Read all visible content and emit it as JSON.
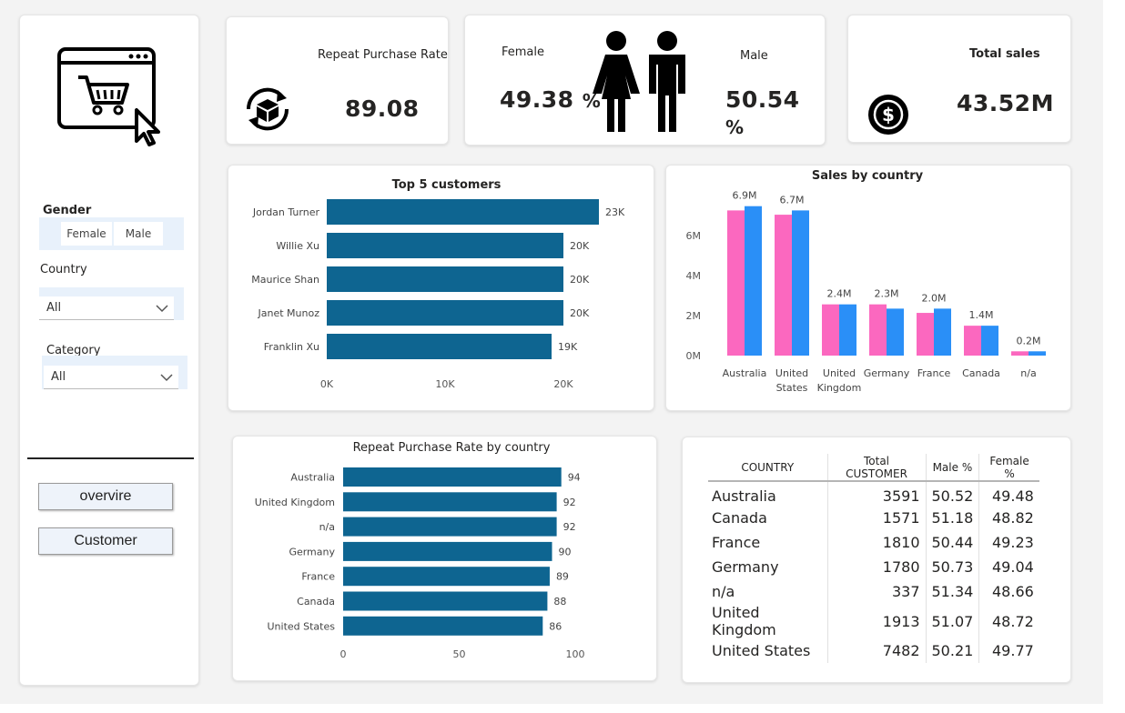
{
  "sidebar": {
    "logo_icon": "shopping-cart-browser-icon",
    "gender": {
      "title": "Gender",
      "options": [
        "Female",
        "Male"
      ]
    },
    "country": {
      "title": "Country",
      "value": "All"
    },
    "category": {
      "title": "Category",
      "value": "All"
    },
    "buttons": [
      "overvire",
      "Customer"
    ]
  },
  "kpis": {
    "repeat_rate": {
      "label": "Repeat Purchase Rate",
      "value": "89.08",
      "icon": "repeat-box-icon"
    },
    "gender": {
      "female_label": "Female",
      "female_value": "49.38",
      "male_label": "Male",
      "male_value": "50.54",
      "unit": "%",
      "icon": "female-male-icon"
    },
    "total_sales": {
      "label": "Total sales",
      "value": "43.52M",
      "icon": "dollar-coin-icon"
    }
  },
  "colors": {
    "bar_blue": "#0e6591",
    "female_pink": "#fb68bf",
    "male_blue": "#2a8ff7"
  },
  "chart_data": [
    {
      "type": "bar",
      "orientation": "horizontal",
      "title": "Top 5 customers",
      "categories": [
        "Jordan Turner",
        "Willie Xu",
        "Maurice Shan",
        "Janet Munoz",
        "Franklin Xu"
      ],
      "values": [
        23000,
        20000,
        20000,
        20000,
        19000
      ],
      "data_labels": [
        "23K",
        "20K",
        "20K",
        "20K",
        "19K"
      ],
      "x_ticks": [
        "0K",
        "10K",
        "20K"
      ],
      "xlim": [
        0,
        25000
      ]
    },
    {
      "type": "bar",
      "title": "Sales by country",
      "categories": [
        "Australia",
        "United States",
        "United Kingdom",
        "Germany",
        "France",
        "Canada",
        "n/a"
      ],
      "category_lines": [
        [
          "Australia"
        ],
        [
          "United",
          "States"
        ],
        [
          "United",
          "Kingdom"
        ],
        [
          "Germany"
        ],
        [
          "France"
        ],
        [
          "Canada"
        ],
        [
          "n/a"
        ]
      ],
      "series": [
        {
          "values": [
            3.4,
            3.3,
            1.2,
            1.2,
            1.0,
            0.7,
            0.1
          ]
        },
        {
          "values": [
            3.5,
            3.4,
            1.2,
            1.1,
            1.1,
            0.7,
            0.1
          ]
        }
      ],
      "totals": [
        6.9,
        6.7,
        2.4,
        2.3,
        2.0,
        1.4,
        0.2
      ],
      "data_labels": [
        "6.9M",
        "6.7M",
        "2.4M",
        "2.3M",
        "2.0M",
        "1.4M",
        "0.2M"
      ],
      "y_ticks": [
        "0M",
        "2M",
        "4M",
        "6M"
      ],
      "ylim": [
        0,
        3.6
      ]
    },
    {
      "type": "bar",
      "orientation": "horizontal",
      "title": "Repeat Purchase Rate by country",
      "categories": [
        "Australia",
        "United Kingdom",
        "n/a",
        "Germany",
        "France",
        "Canada",
        "United States"
      ],
      "values": [
        94,
        92,
        92,
        90,
        89,
        88,
        86
      ],
      "x_ticks": [
        "0",
        "50",
        "100"
      ],
      "xlim": [
        0,
        100
      ]
    }
  ],
  "table": {
    "headers": [
      "COUNTRY",
      "Total CUSTOMER",
      "Male %",
      "Female %"
    ],
    "rows": [
      [
        "Australia",
        "3591",
        "50.52",
        "49.48"
      ],
      [
        "Canada",
        "1571",
        "51.18",
        "48.82"
      ],
      [
        "France",
        "1810",
        "50.44",
        "49.23"
      ],
      [
        "Germany",
        "1780",
        "50.73",
        "49.04"
      ],
      [
        "n/a",
        "337",
        "51.34",
        "48.66"
      ],
      [
        "United Kingdom",
        "1913",
        "51.07",
        "48.72"
      ],
      [
        "United States",
        "7482",
        "50.21",
        "49.77"
      ]
    ]
  }
}
